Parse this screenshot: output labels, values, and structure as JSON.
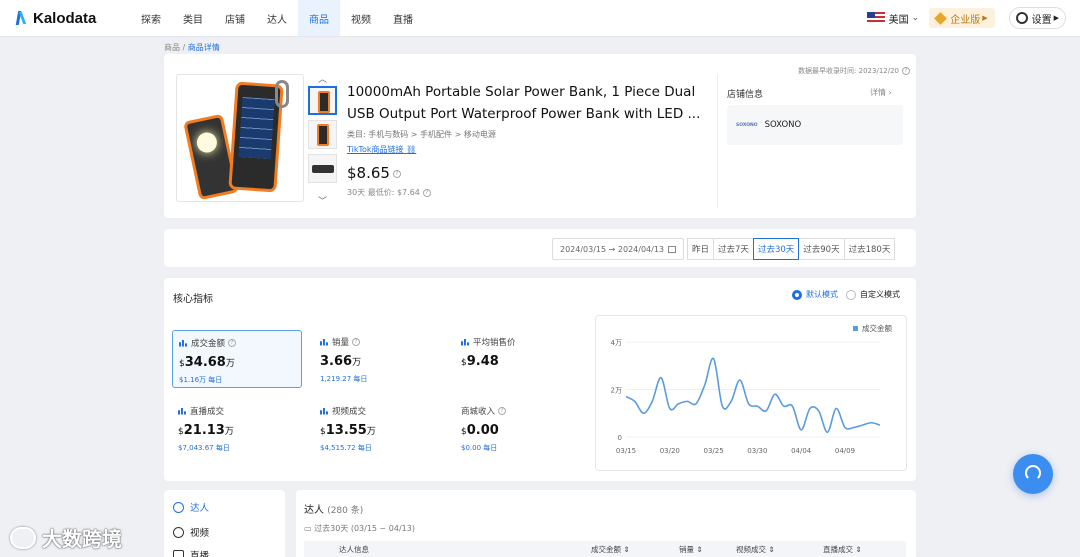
{
  "nav": {
    "logo": "Kalodata",
    "items": [
      "探索",
      "类目",
      "店铺",
      "达人",
      "商品",
      "视频",
      "直播"
    ],
    "active_index": 4,
    "region": "美国",
    "enterprise": "企业版",
    "settings": "设置"
  },
  "breadcrumb": {
    "parent": "商品",
    "sep": " / ",
    "current": "商品详情"
  },
  "product": {
    "collect_time": "数据最早收录时间: 2023/12/20",
    "title": "10000mAh Portable Solar Power Bank, 1 Piece Dual USB Output Port Waterproof Power Bank with LED ...",
    "category": "类目: 手机与数码 > 手机配件 > 移动电源",
    "tiktok_link": "TikTok商品链接",
    "price": "$8.65",
    "low_price": "30天 最低价: $7.64"
  },
  "store": {
    "label": "店铺信息",
    "detail": "详情 ›",
    "logo_text": "SOXONO",
    "name": "SOXONO"
  },
  "date_filter": {
    "range": "2024/03/15 → 2024/04/13",
    "options": [
      "昨日",
      "过去7天",
      "过去30天",
      "过去90天",
      "过去180天"
    ],
    "active_index": 2
  },
  "metrics": {
    "title": "核心指标",
    "mode_default": "默认模式",
    "mode_custom": "自定义模式",
    "items": [
      {
        "label": "成交金额",
        "prefix": "$",
        "value": "34.68",
        "unit": "万",
        "sub": "$1.16万 每日"
      },
      {
        "label": "销量",
        "prefix": "",
        "value": "3.66",
        "unit": "万",
        "sub": "1,219.27 每日"
      },
      {
        "label": "平均销售价",
        "prefix": "$",
        "value": "9.48",
        "unit": "",
        "sub": ""
      },
      {
        "label": "直播成交",
        "prefix": "$",
        "value": "21.13",
        "unit": "万",
        "sub": "$7,043.67 每日"
      },
      {
        "label": "视频成交",
        "prefix": "$",
        "value": "13.55",
        "unit": "万",
        "sub": "$4,515.72 每日"
      },
      {
        "label": "商城收入",
        "prefix": "$",
        "value": "0.00",
        "unit": "",
        "sub": "$0.00 每日"
      }
    ]
  },
  "chart_data": {
    "type": "line",
    "legend": "成交金额",
    "legend_position": "top-right",
    "y_ticks": [
      "4万",
      "2万",
      "0"
    ],
    "ylim": [
      0,
      40000
    ],
    "x_ticks": [
      "03/15",
      "03/20",
      "03/25",
      "03/30",
      "04/04",
      "04/09"
    ],
    "series": [
      {
        "name": "成交金额",
        "color": "#5a9be0",
        "x": [
          "03/15",
          "03/16",
          "03/17",
          "03/18",
          "03/19",
          "03/20",
          "03/21",
          "03/22",
          "03/23",
          "03/24",
          "03/25",
          "03/26",
          "03/27",
          "03/28",
          "03/29",
          "03/30",
          "03/31",
          "04/01",
          "04/02",
          "04/03",
          "04/04",
          "04/05",
          "04/06",
          "04/07",
          "04/08",
          "04/09",
          "04/10",
          "04/11",
          "04/12",
          "04/13"
        ],
        "values": [
          17000,
          15000,
          10000,
          15000,
          25000,
          12000,
          14000,
          15000,
          14000,
          22000,
          33000,
          13000,
          15000,
          24000,
          14000,
          13000,
          11000,
          18000,
          13000,
          13000,
          3000,
          12000,
          11000,
          2000,
          12000,
          4000,
          4000,
          5000,
          6000,
          5000
        ]
      }
    ]
  },
  "sidebar": {
    "items": [
      "达人",
      "视频",
      "直播"
    ],
    "active_index": 0
  },
  "table": {
    "title": "达人",
    "count": "(280 条)",
    "range": "过去30天 (03/15 ~ 04/13)",
    "columns": [
      "达人信息",
      "成交金额 ⇕",
      "销量 ⇕",
      "视频成交 ⇕",
      "直播成交 ⇕"
    ]
  },
  "watermark": "大数跨境"
}
